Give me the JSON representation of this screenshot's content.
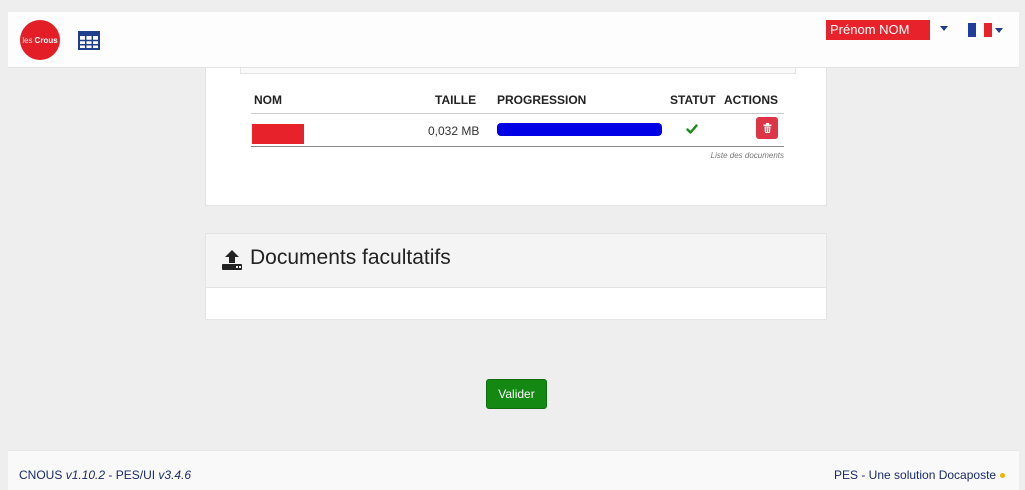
{
  "header": {
    "logo_text": "les Crous",
    "logo_text_thin": "les",
    "logo_text_bold": "Crous",
    "user_name": "Prénom NOM",
    "language": "fr",
    "icons": {
      "grid": "table-grid-icon",
      "caret": "caret-down-icon"
    },
    "colors": {
      "brand_red": "#e41e26",
      "navy": "#1f3e8c"
    }
  },
  "documents_table": {
    "columns": [
      "NOM",
      "TAILLE",
      "PROGRESSION",
      "STATUT",
      "ACTIONS"
    ],
    "rows": [
      {
        "name": "",
        "size": "0,032 MB",
        "progress": 1.0,
        "status": "success"
      }
    ],
    "caption": "Liste des documents",
    "colors": {
      "progress": "#0000e6",
      "check": "#1e8a1e",
      "delete": "#dc3545"
    }
  },
  "optional_documents": {
    "title": "Documents facultatifs",
    "icon": "upload-icon"
  },
  "actions": {
    "validate_label": "Valider",
    "validate_color": "#138813"
  },
  "footer": {
    "left_app": "CNOUS",
    "left_app_version": "v1.10.2",
    "left_separator": " - PES/UI ",
    "left_ui_version": "v3.4.6",
    "right_text": "PES - Une solution Docaposte"
  }
}
